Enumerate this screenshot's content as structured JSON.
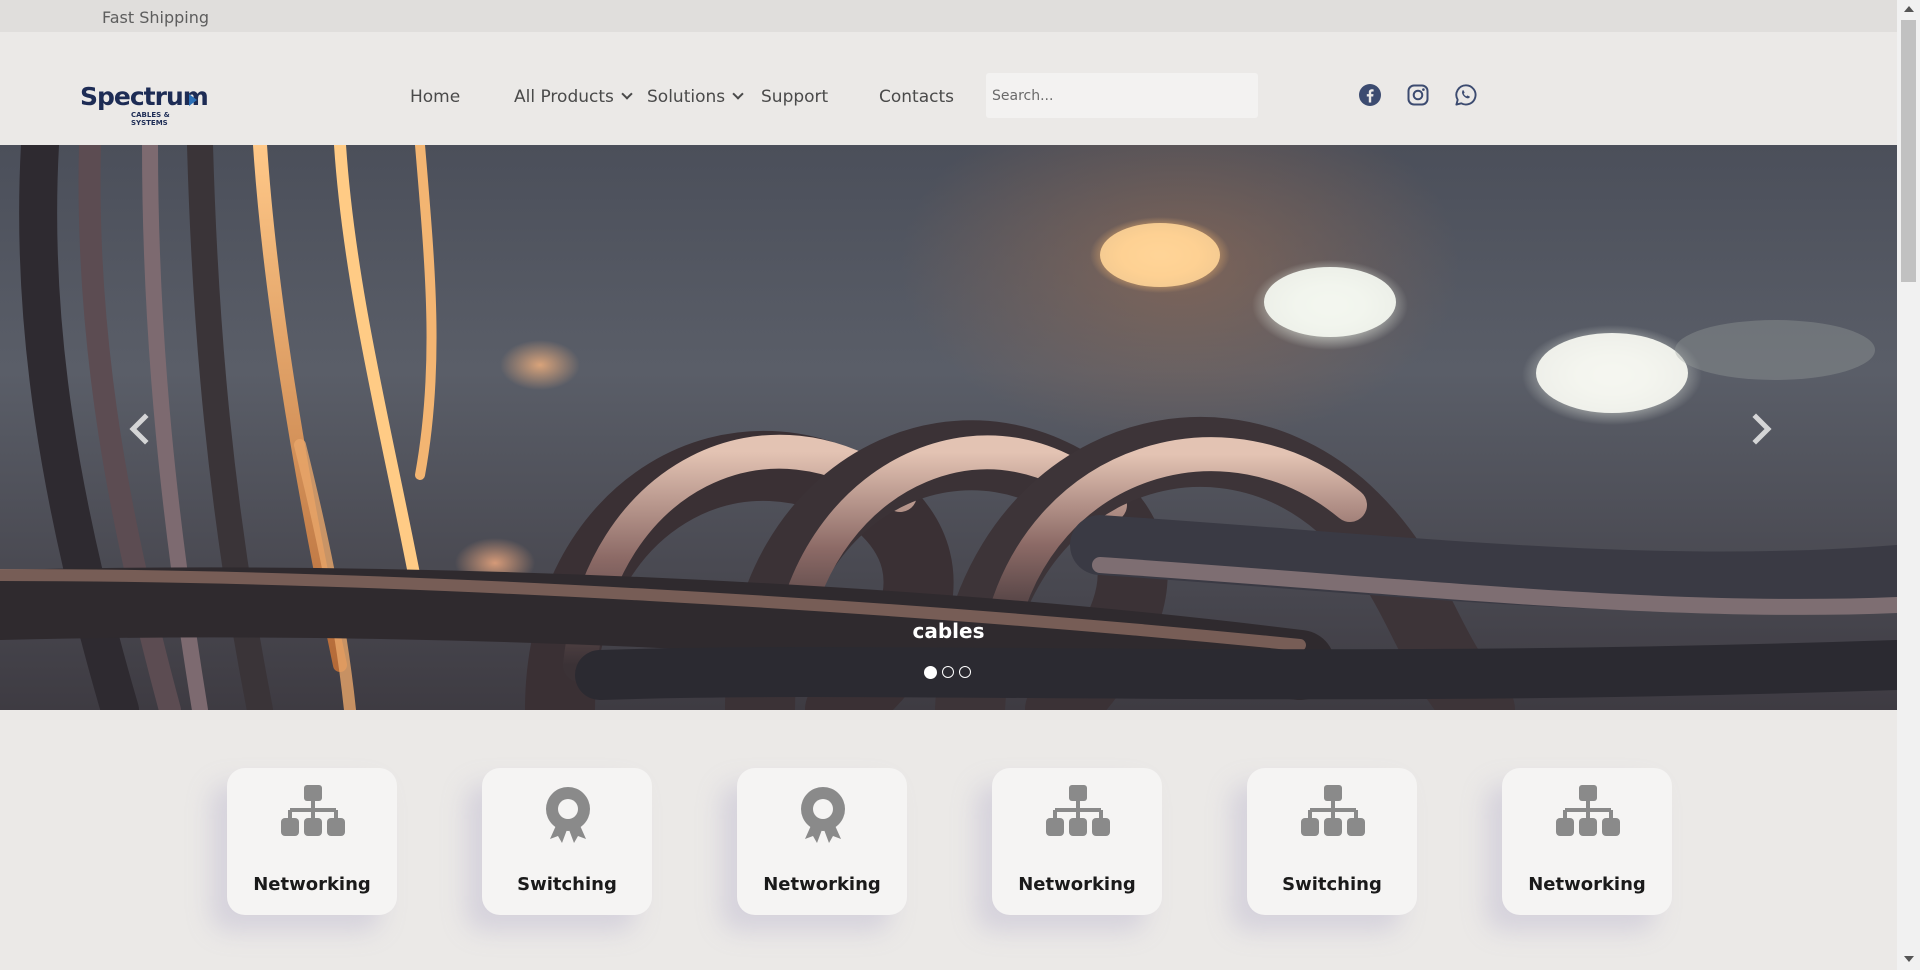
{
  "topbar": {
    "text": "Fast Shipping"
  },
  "header": {
    "logo": {
      "word": "Spectrum",
      "tagline": "CABLES & SYSTEMS"
    },
    "nav": [
      {
        "label": "Home",
        "dropdown": false
      },
      {
        "label": "All Products",
        "dropdown": true
      },
      {
        "label": "Solutions",
        "dropdown": true
      },
      {
        "label": "Support",
        "dropdown": false
      },
      {
        "label": "Contacts",
        "dropdown": false
      }
    ],
    "search": {
      "placeholder": "Search...",
      "value": ""
    },
    "social": [
      "facebook-icon",
      "instagram-icon",
      "whatsapp-icon"
    ]
  },
  "hero": {
    "caption": "cables",
    "slides_count": 3,
    "active_slide": 1
  },
  "categories": [
    {
      "label": "Networking",
      "icon": "sitemap-icon"
    },
    {
      "label": "Switching",
      "icon": "award-icon"
    },
    {
      "label": "Networking",
      "icon": "award-icon"
    },
    {
      "label": "Networking",
      "icon": "sitemap-icon"
    },
    {
      "label": "Switching",
      "icon": "sitemap-icon"
    },
    {
      "label": "Networking",
      "icon": "sitemap-icon"
    }
  ],
  "colors": {
    "brand": "#1d2c55",
    "social_icon": "#3c4b70",
    "category_icon": "#8a8a8a"
  }
}
